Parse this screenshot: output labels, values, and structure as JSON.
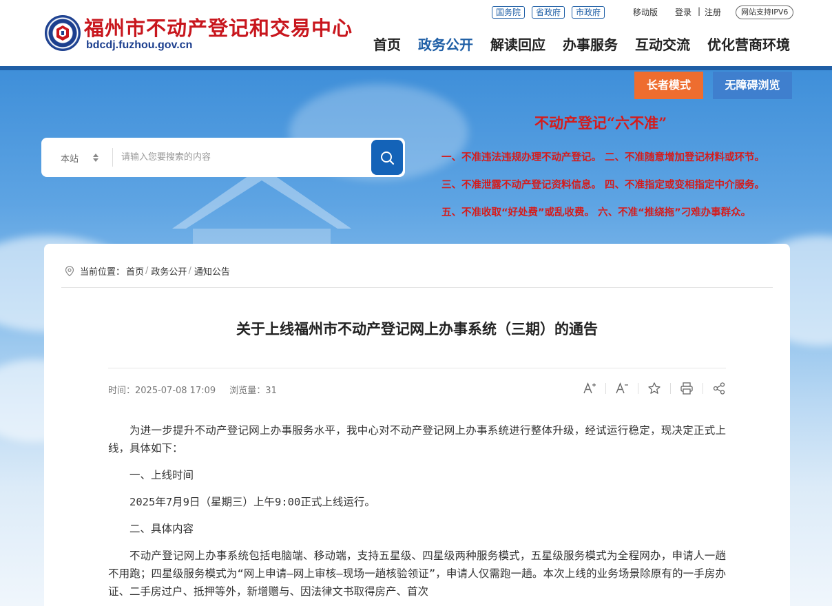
{
  "site": {
    "title": "福州市不动产登记和交易中心",
    "url": "bdcdj.fuzhou.gov.cn"
  },
  "top_links": {
    "pills": [
      "国务院",
      "省政府",
      "市政府"
    ],
    "mobile": "移动版",
    "login": "登录",
    "separator": "|",
    "register": "注册",
    "ipv6": "网站支持IPV6"
  },
  "nav": {
    "items": [
      "首页",
      "政务公开",
      "解读回应",
      "办事服务",
      "互动交流",
      "优化营商环境"
    ],
    "active": "政务公开"
  },
  "banner": {
    "elder_mode": "长者模式",
    "accessible": "无障碍浏览",
    "six_title": "不动产登记“六不准”",
    "six_lines": [
      "一、不准违法违规办理不动产登记。 二、不准随意增加登记材料或环节。",
      "三、不准泄露不动产登记资料信息。 四、不准指定或变相指定中介服务。",
      "五、不准收取“好处费”或乱收费。 六、不准“推绕拖”刁难办事群众。"
    ]
  },
  "search": {
    "scope": "本站",
    "placeholder": "请输入您要搜索的内容"
  },
  "breadcrumb": {
    "label": "当前位置：",
    "items": [
      "首页",
      "政务公开",
      "通知公告"
    ]
  },
  "article": {
    "title": "关于上线福州市不动产登记网上办事系统（三期）的通告",
    "time_label": "时间：2025-07-08 17:09",
    "views_label": "浏览量：31",
    "paragraphs": [
      "为进一步提升不动产登记网上办事服务水平，我中心对不动产登记网上办事系统进行整体升级，经试运行稳定，现决定正式上线，具体如下：",
      "一、上线时间",
      "2025年7月9日（星期三）上午9:00正式上线运行。",
      "二、具体内容",
      "不动产登记网上办事系统包括电脑端、移动端，支持五星级、四星级两种服务模式，五星级服务模式为全程网办，申请人一趟不用跑；四星级服务模式为“网上申请—网上审核—现场一趟核验领证”，申请人仅需跑一趟。本次上线的业务场景除原有的一手房办证、二手房过户、抵押等外，新增赠与、因法律文书取得房产、首次"
    ]
  },
  "tools": [
    "A+",
    "A-",
    "star-icon",
    "print-icon",
    "share-icon"
  ]
}
